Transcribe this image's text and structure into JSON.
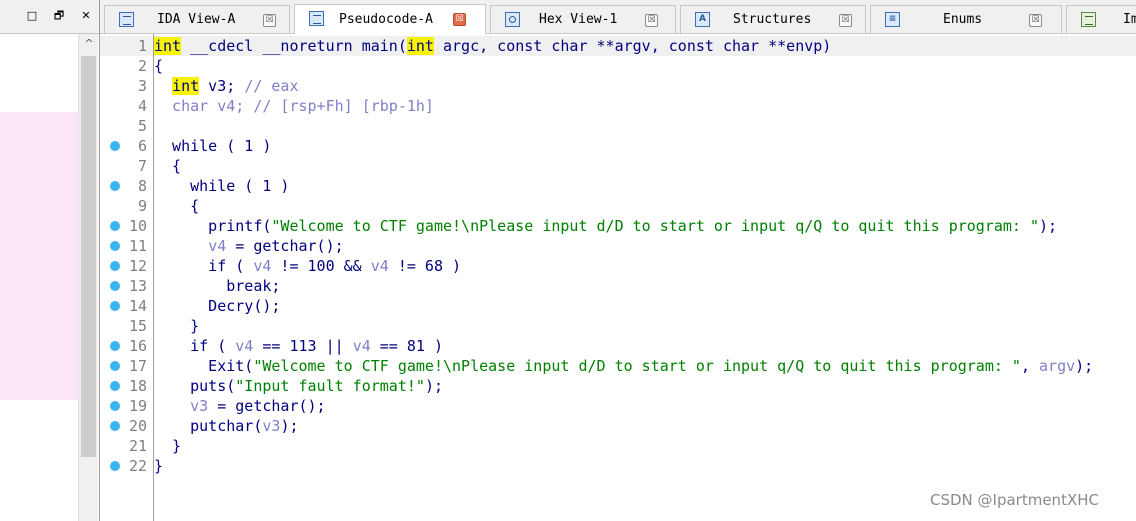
{
  "left_panel": {
    "restore_glyph": "□",
    "float_glyph": "🗗",
    "close_glyph": "✕",
    "scroll_up_glyph": "^"
  },
  "tabs": [
    {
      "label": "IDA View-A",
      "icon": "disassembly-icon",
      "close": "☒",
      "active": false
    },
    {
      "label": "Pseudocode-A",
      "icon": "pseudocode-icon",
      "close": "☒",
      "active": true
    },
    {
      "label": "Hex View-1",
      "icon": "hex-view-icon",
      "close": "☒",
      "active": false
    },
    {
      "label": "Structures",
      "icon": "structures-icon",
      "close": "☒",
      "active": false
    },
    {
      "label": "Enums",
      "icon": "enums-icon",
      "close": "☒",
      "active": false
    },
    {
      "label": "Im",
      "icon": "imports-icon",
      "close": "",
      "active": false
    }
  ],
  "tab_icon_letters": {
    "structures": "A",
    "enums": "≡"
  },
  "code_lines": [
    {
      "no": "1",
      "bp": false,
      "tokens": [
        [
          "int",
          "kw"
        ],
        [
          " __cdecl __noreturn main(",
          ""
        ],
        [
          "int",
          "kw"
        ],
        [
          " argc, const char **argv, const char **envp)",
          ""
        ]
      ]
    },
    {
      "no": "2",
      "bp": false,
      "tokens": [
        [
          "{",
          ""
        ]
      ]
    },
    {
      "no": "3",
      "bp": false,
      "tokens": [
        [
          "  ",
          ""
        ],
        [
          "int",
          "kw"
        ],
        [
          " v3; ",
          ""
        ],
        [
          "// eax",
          "cmt"
        ]
      ]
    },
    {
      "no": "4",
      "bp": false,
      "tokens": [
        [
          "  char v4; ",
          "var"
        ],
        [
          "// [rsp+Fh] [rbp-1h]",
          "cmt"
        ]
      ]
    },
    {
      "no": "5",
      "bp": false,
      "tokens": [
        [
          "",
          ""
        ]
      ]
    },
    {
      "no": "6",
      "bp": true,
      "tokens": [
        [
          "  while ( 1 )",
          ""
        ]
      ]
    },
    {
      "no": "7",
      "bp": false,
      "tokens": [
        [
          "  {",
          ""
        ]
      ]
    },
    {
      "no": "8",
      "bp": true,
      "tokens": [
        [
          "    while ( 1 )",
          ""
        ]
      ]
    },
    {
      "no": "9",
      "bp": false,
      "tokens": [
        [
          "    {",
          ""
        ]
      ]
    },
    {
      "no": "10",
      "bp": true,
      "tokens": [
        [
          "      printf(",
          ""
        ],
        [
          "\"Welcome to CTF game!\\nPlease input d/D to start or input q/Q to quit this program: \"",
          "str"
        ],
        [
          ");",
          ""
        ]
      ]
    },
    {
      "no": "11",
      "bp": true,
      "tokens": [
        [
          "      ",
          ""
        ],
        [
          "v4",
          "var"
        ],
        [
          " = getchar();",
          ""
        ]
      ]
    },
    {
      "no": "12",
      "bp": true,
      "tokens": [
        [
          "      if ( ",
          ""
        ],
        [
          "v4",
          "var"
        ],
        [
          " != 100 && ",
          ""
        ],
        [
          "v4",
          "var"
        ],
        [
          " != 68 )",
          ""
        ]
      ]
    },
    {
      "no": "13",
      "bp": true,
      "tokens": [
        [
          "        break;",
          ""
        ]
      ]
    },
    {
      "no": "14",
      "bp": true,
      "tokens": [
        [
          "      Decry();",
          ""
        ]
      ]
    },
    {
      "no": "15",
      "bp": false,
      "tokens": [
        [
          "    }",
          ""
        ]
      ]
    },
    {
      "no": "16",
      "bp": true,
      "tokens": [
        [
          "    if ( ",
          ""
        ],
        [
          "v4",
          "var"
        ],
        [
          " == 113 || ",
          ""
        ],
        [
          "v4",
          "var"
        ],
        [
          " == 81 )",
          ""
        ]
      ]
    },
    {
      "no": "17",
      "bp": true,
      "tokens": [
        [
          "      Exit(",
          ""
        ],
        [
          "\"Welcome to CTF game!\\nPlease input d/D to start or input q/Q to quit this program: \"",
          "str"
        ],
        [
          ", ",
          ""
        ],
        [
          "argv",
          "var"
        ],
        [
          ");",
          ""
        ]
      ]
    },
    {
      "no": "18",
      "bp": true,
      "tokens": [
        [
          "    puts(",
          ""
        ],
        [
          "\"Input fault format!\"",
          "str"
        ],
        [
          ");",
          ""
        ]
      ]
    },
    {
      "no": "19",
      "bp": true,
      "tokens": [
        [
          "    ",
          ""
        ],
        [
          "v3",
          "var"
        ],
        [
          " = getchar();",
          ""
        ]
      ]
    },
    {
      "no": "20",
      "bp": true,
      "tokens": [
        [
          "    putchar(",
          ""
        ],
        [
          "v3",
          "var"
        ],
        [
          ");",
          ""
        ]
      ]
    },
    {
      "no": "21",
      "bp": false,
      "tokens": [
        [
          "  }",
          ""
        ]
      ]
    },
    {
      "no": "22",
      "bp": true,
      "tokens": [
        [
          "}",
          ""
        ]
      ]
    }
  ],
  "watermark": "CSDN @IpartmentXHC",
  "colors": {
    "keyword_highlight": "#f7f300",
    "code_text": "#000080",
    "variable": "#8080c8",
    "string": "#008000",
    "breakpoint_dot": "#3fb3f2",
    "close_active": "#e06c4a"
  }
}
